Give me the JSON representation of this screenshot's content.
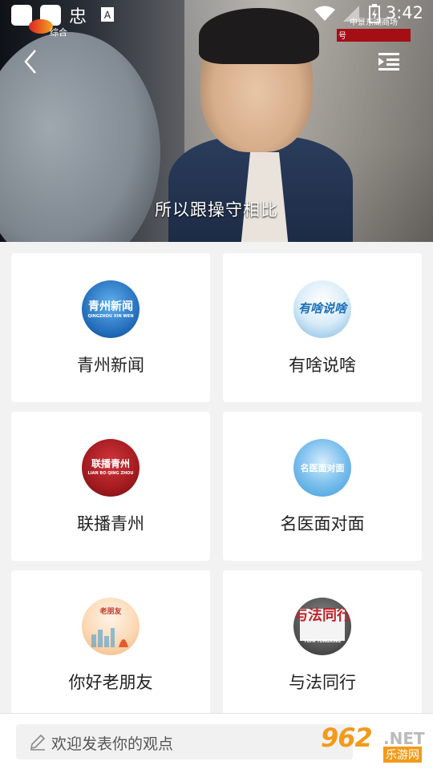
{
  "status_bar": {
    "time": "3:42",
    "battery_icon": "battery-charging-icon",
    "wifi_icon": "wifi-icon"
  },
  "video": {
    "channel_logo_text": "综合",
    "station_text": "中景东湖商场",
    "overlay_char": "号",
    "subtitle": "所以跟操守相比"
  },
  "cards": [
    {
      "label": "青州新闻",
      "icon_text": "青州新闻",
      "icon_sub": "QINGZHOU XIN WEN",
      "color": "#1f68b6"
    },
    {
      "label": "有啥说啥",
      "icon_text": "有啥说啥",
      "icon_sub": "",
      "color": "#2a8bd1"
    },
    {
      "label": "联播青州",
      "icon_text": "联播青州",
      "icon_sub": "LIAN BO QING ZHOU",
      "color": "#a31b20"
    },
    {
      "label": "名医面对面",
      "icon_text": "名医面对面",
      "icon_sub": "",
      "color": "#3e9ad8"
    },
    {
      "label": "你好老朋友",
      "icon_text": "老朋友",
      "icon_sub": "",
      "color": "#f3b37a"
    },
    {
      "label": "与法同行",
      "icon_text": "与法同行",
      "icon_sub": "YUFA TONGXING",
      "color": "#555555"
    }
  ],
  "comment": {
    "placeholder": "欢迎发表你的观点"
  },
  "watermark": {
    "number": "962",
    "net": ".NET",
    "site": "乐游网"
  }
}
